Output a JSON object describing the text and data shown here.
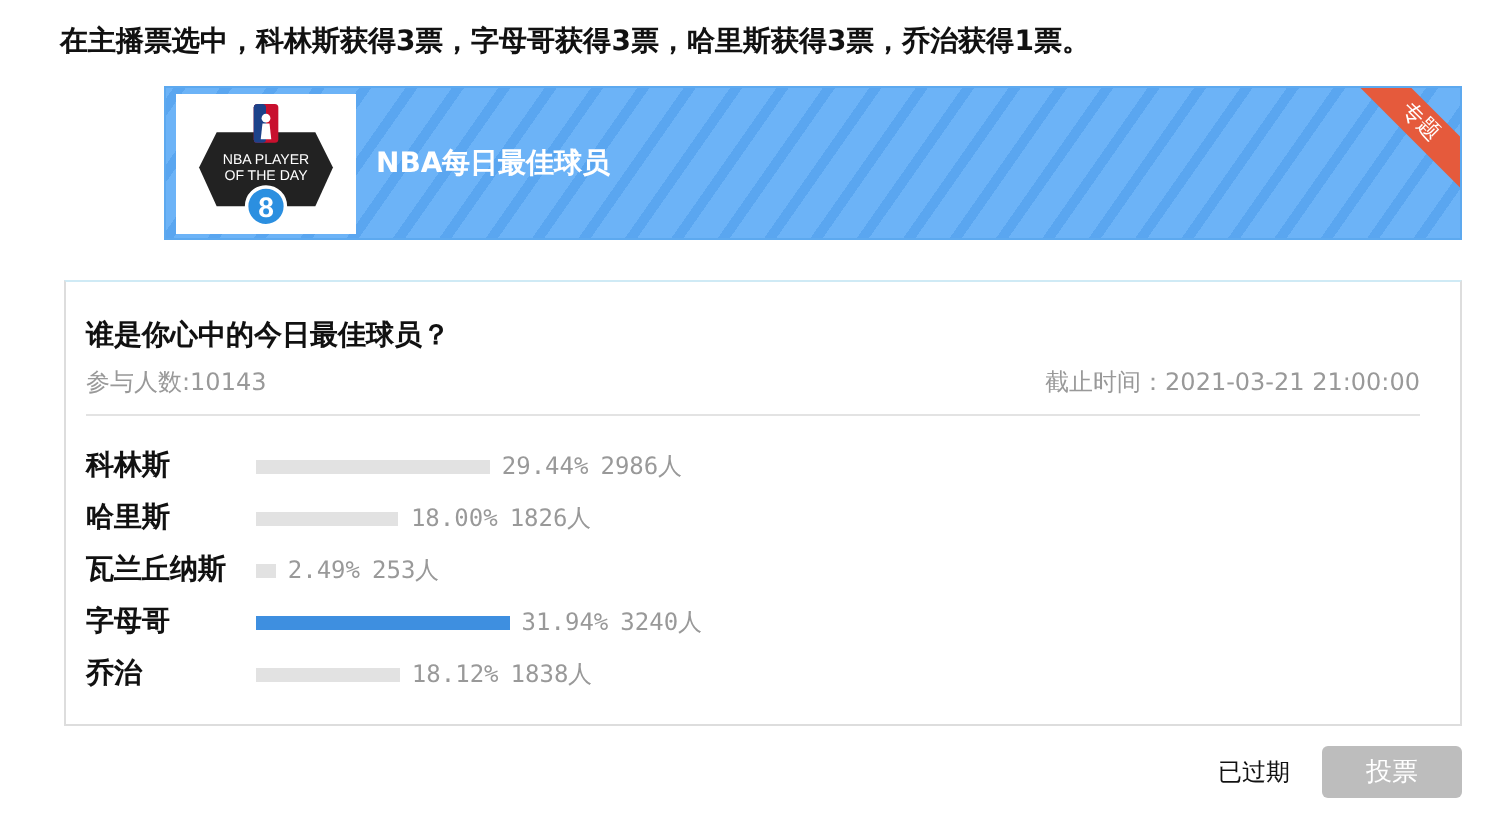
{
  "headline": "在主播票选中，科林斯获得3票，字母哥获得3票，哈里斯获得3票，乔治获得1票。",
  "banner": {
    "logo_lines": [
      "NBA PLAYER",
      "OF THE DAY"
    ],
    "logo_number": "8",
    "title": "NBA每日最佳球员",
    "ribbon": "专题"
  },
  "poll": {
    "question": "谁是你心中的今日最佳球员？",
    "participants": "参与人数:10143",
    "deadline": "截止时间：2021-03-21 21:00:00",
    "options": [
      {
        "name": "科林斯",
        "percent": "29.44%",
        "votes": "2986人",
        "leading": false
      },
      {
        "name": "哈里斯",
        "percent": "18.00%",
        "votes": "1826人",
        "leading": false
      },
      {
        "name": "瓦兰丘纳斯",
        "percent": "2.49%",
        "votes": "253人",
        "leading": false
      },
      {
        "name": "字母哥",
        "percent": "31.94%",
        "votes": "3240人",
        "leading": true
      },
      {
        "name": "乔治",
        "percent": "18.12%",
        "votes": "1838人",
        "leading": false
      }
    ]
  },
  "footer": {
    "status": "已过期",
    "vote_button": {
      "label": "投票",
      "disabled": true
    }
  }
}
